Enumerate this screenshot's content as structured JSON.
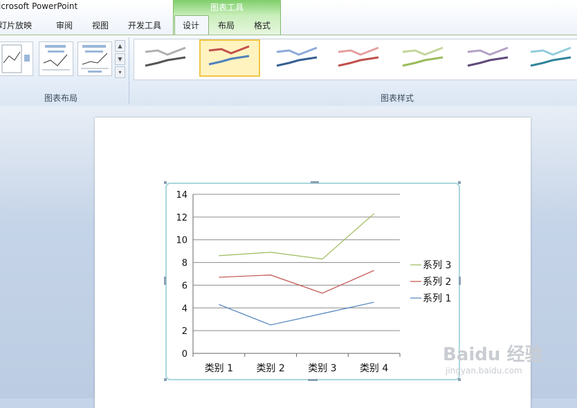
{
  "app": {
    "title": "icrosoft PowerPoint"
  },
  "tabs": [
    "灯片放映",
    "审阅",
    "视图",
    "开发工具"
  ],
  "context_group": {
    "title": "图表工具",
    "tabs": [
      "设计",
      "布局",
      "格式"
    ],
    "active": "设计"
  },
  "ribbon": {
    "groups": [
      {
        "label": "图表布局"
      },
      {
        "label": "图表样式"
      }
    ]
  },
  "chart_styles": {
    "selected_index": 1,
    "swatches": [
      {
        "top": "#b0b0b0",
        "bottom": "#555555"
      },
      {
        "top": "#c0504d",
        "bottom": "#4f81bd"
      },
      {
        "top": "#8eaadb",
        "bottom": "#365f91"
      },
      {
        "top": "#e6a0a0",
        "bottom": "#c0504d"
      },
      {
        "top": "#c3d69b",
        "bottom": "#9bbb59"
      },
      {
        "top": "#b3a2c7",
        "bottom": "#604a7b"
      },
      {
        "top": "#93cddd",
        "bottom": "#31859c"
      }
    ]
  },
  "chart_data": {
    "type": "line",
    "categories": [
      "类别 1",
      "类别 2",
      "类别 3",
      "类别 4"
    ],
    "series": [
      {
        "name": "系列 1",
        "values": [
          4.3,
          2.5,
          3.5,
          4.5
        ],
        "color": "#4f81bd"
      },
      {
        "name": "系列 2",
        "values": [
          6.7,
          6.9,
          5.3,
          7.3
        ],
        "color": "#c0504d"
      },
      {
        "name": "系列 3",
        "values": [
          8.6,
          8.9,
          8.3,
          12.3
        ],
        "color": "#9bbb59"
      }
    ],
    "ylim": [
      0,
      14
    ],
    "yticks": [
      "0",
      "2",
      "4",
      "6",
      "8",
      "10",
      "12",
      "14"
    ],
    "grid": true,
    "legend": "right",
    "title": "",
    "xlabel": "",
    "ylabel": ""
  },
  "watermark": {
    "text": "Baidu 经验",
    "sub": "jingyan.baidu.com"
  }
}
